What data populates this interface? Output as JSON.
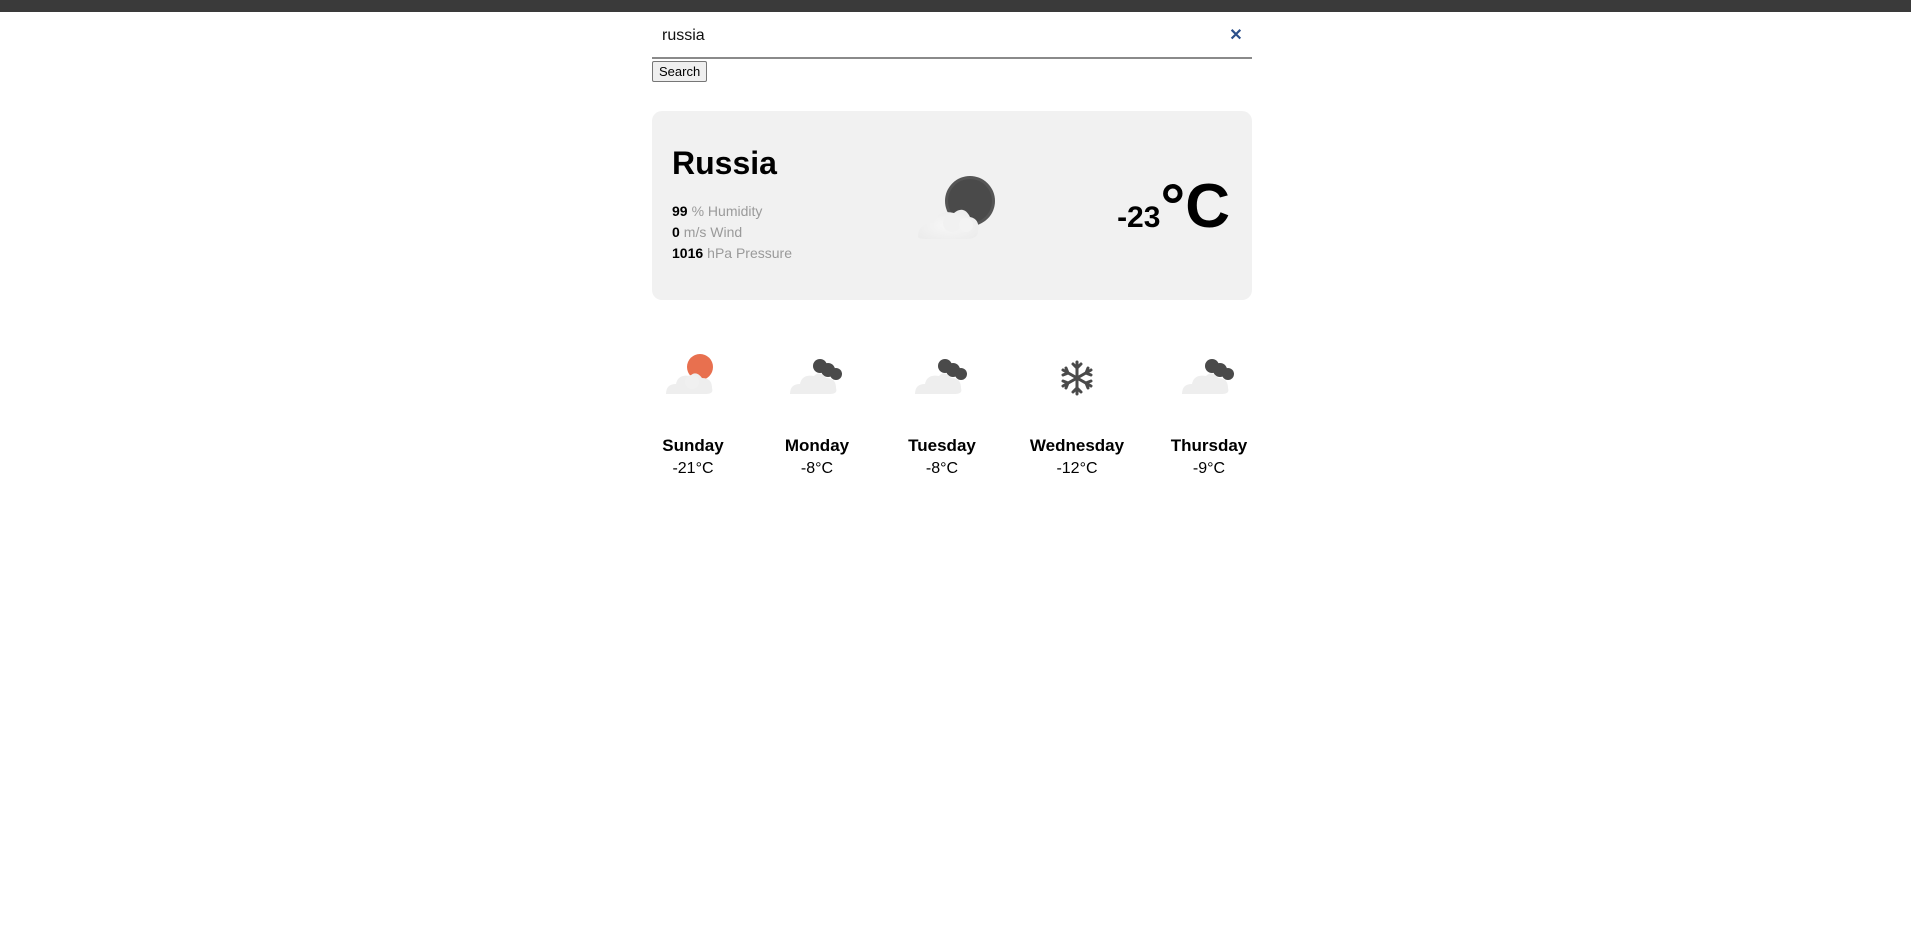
{
  "search": {
    "value": "russia",
    "button_label": "Search",
    "clear_glyph": "✕"
  },
  "current": {
    "city": "Russia",
    "icon": "night-cloud-icon",
    "humidity": {
      "value": "99",
      "label": "% Humidity"
    },
    "wind": {
      "value": "0",
      "label": "m/s Wind"
    },
    "pressure": {
      "value": "1016",
      "label": "hPa Pressure"
    },
    "temp": "-23",
    "unit": "°C"
  },
  "forecast": [
    {
      "day": "Sunday",
      "temp": "-21°C",
      "icon": "cloud-sun-icon"
    },
    {
      "day": "Monday",
      "temp": "-8°C",
      "icon": "cloud-moon-icon"
    },
    {
      "day": "Tuesday",
      "temp": "-8°C",
      "icon": "cloud-moon-icon"
    },
    {
      "day": "Wednesday",
      "temp": "-12°C",
      "icon": "snowflake-icon"
    },
    {
      "day": "Thursday",
      "temp": "-9°C",
      "icon": "cloud-moon-icon"
    }
  ],
  "colors": {
    "card_bg": "#f1f1f1",
    "moon": "#4a4a4a",
    "sun": "#e8704f",
    "cloud": "#eeeeee",
    "clear_icon": "#2b4f8a"
  }
}
